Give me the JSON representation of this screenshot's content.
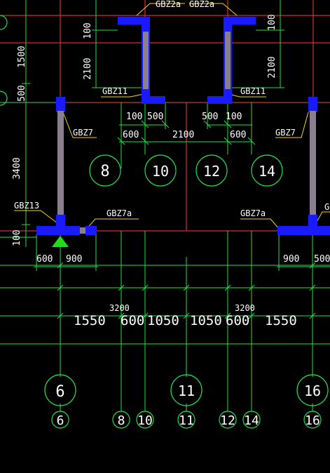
{
  "colors": {
    "background": "#000000",
    "axis_line": "#ff3b3b",
    "dimension_line": "#22e04a",
    "leader": "#ffd400",
    "column_fill": "#1a1aff",
    "wall_fill": "#8a7f8f",
    "marker": "#19e019",
    "text": "#ffffff"
  },
  "labels": {
    "gbz2a_left": "GBZ2a",
    "gbz2a_right": "GBZ2a",
    "gbz11_left": "GBZ11",
    "gbz11_right": "GBZ11",
    "gbz7_left": "GBZ7",
    "gbz7_right": "GBZ7",
    "gbz13": "GBZ13",
    "gbz7a_left": "GBZ7a",
    "gbz7a_right": "GBZ7a",
    "g_cut": "G"
  },
  "dimensions": {
    "d100_top_left": "100",
    "d100_top_right": "100",
    "d2100_left": "2100",
    "d2100_right": "2100",
    "d1500": "1500",
    "d500_side": "500",
    "d3400": "3400",
    "d100_side": "100",
    "d100_a": "100",
    "d500_a": "500",
    "d500_b": "500",
    "d100_b": "100",
    "d600_a": "600",
    "d2100_mid": "2100",
    "d600_b": "600",
    "d600_bottom_left": "600",
    "d900_bottom_left": "900",
    "d900_bottom_right": "900",
    "d500_bottom_right": "500",
    "d3200_left": "3200",
    "d3200_right": "3200",
    "seg1550_a": "1550",
    "seg600_a": "600",
    "seg1050_a": "1050",
    "seg1050_b": "1050",
    "seg600_b": "600",
    "seg1550_b": "1550"
  },
  "axes": {
    "bubble_8": "8",
    "bubble_10": "10",
    "bubble_12": "12",
    "bubble_14": "14",
    "big_6": "6",
    "big_11": "11",
    "big_16": "16",
    "small_6": "6",
    "small_8": "8",
    "small_10": "10",
    "small_11": "11",
    "small_12": "12",
    "small_14": "14",
    "small_16": "16"
  }
}
